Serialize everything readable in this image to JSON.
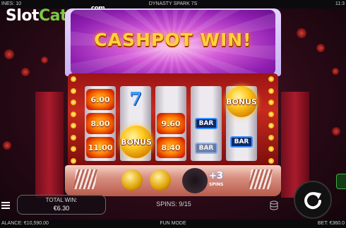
{
  "topbar": {
    "lines": "INES: 10",
    "game_title": "DYNASTY SPARK 7S",
    "clock": "11:3"
  },
  "watermark": {
    "slot": "Slot",
    "catalog": "Catalog",
    "com": ".com"
  },
  "banner": {
    "title": "CASHPOT WIN!"
  },
  "reels": {
    "reel1": [
      "6.00",
      "8.00",
      "11.00"
    ],
    "reel2": [
      "7",
      "BONUS"
    ],
    "reel3": [
      "9.60",
      "8.40"
    ],
    "reel4": [
      "BAR",
      "BAR"
    ],
    "reel5": [
      "BONUS",
      "BAR"
    ]
  },
  "bonus_label": "BONUS",
  "extra_spins": {
    "amount": "+3",
    "label": "SPINS"
  },
  "total_win": {
    "label": "TOTAL WIN:",
    "value": "€6.30"
  },
  "spins": {
    "label": "SPINS:",
    "value": "9/15"
  },
  "bottombar": {
    "balance": "ALANCE: €10,590.00",
    "mode": "FUN MODE",
    "bet": "BET: €360.0"
  },
  "colors": {
    "accent_gold": "#ffd23a",
    "banner_purple": "#8f1fb0",
    "frame_red": "#c72a1e",
    "watermark_green": "#7ac943"
  },
  "icons": {
    "menu": "hamburger-icon",
    "spin": "spin-arrow-icon",
    "stack": "coin-stack-icon"
  }
}
